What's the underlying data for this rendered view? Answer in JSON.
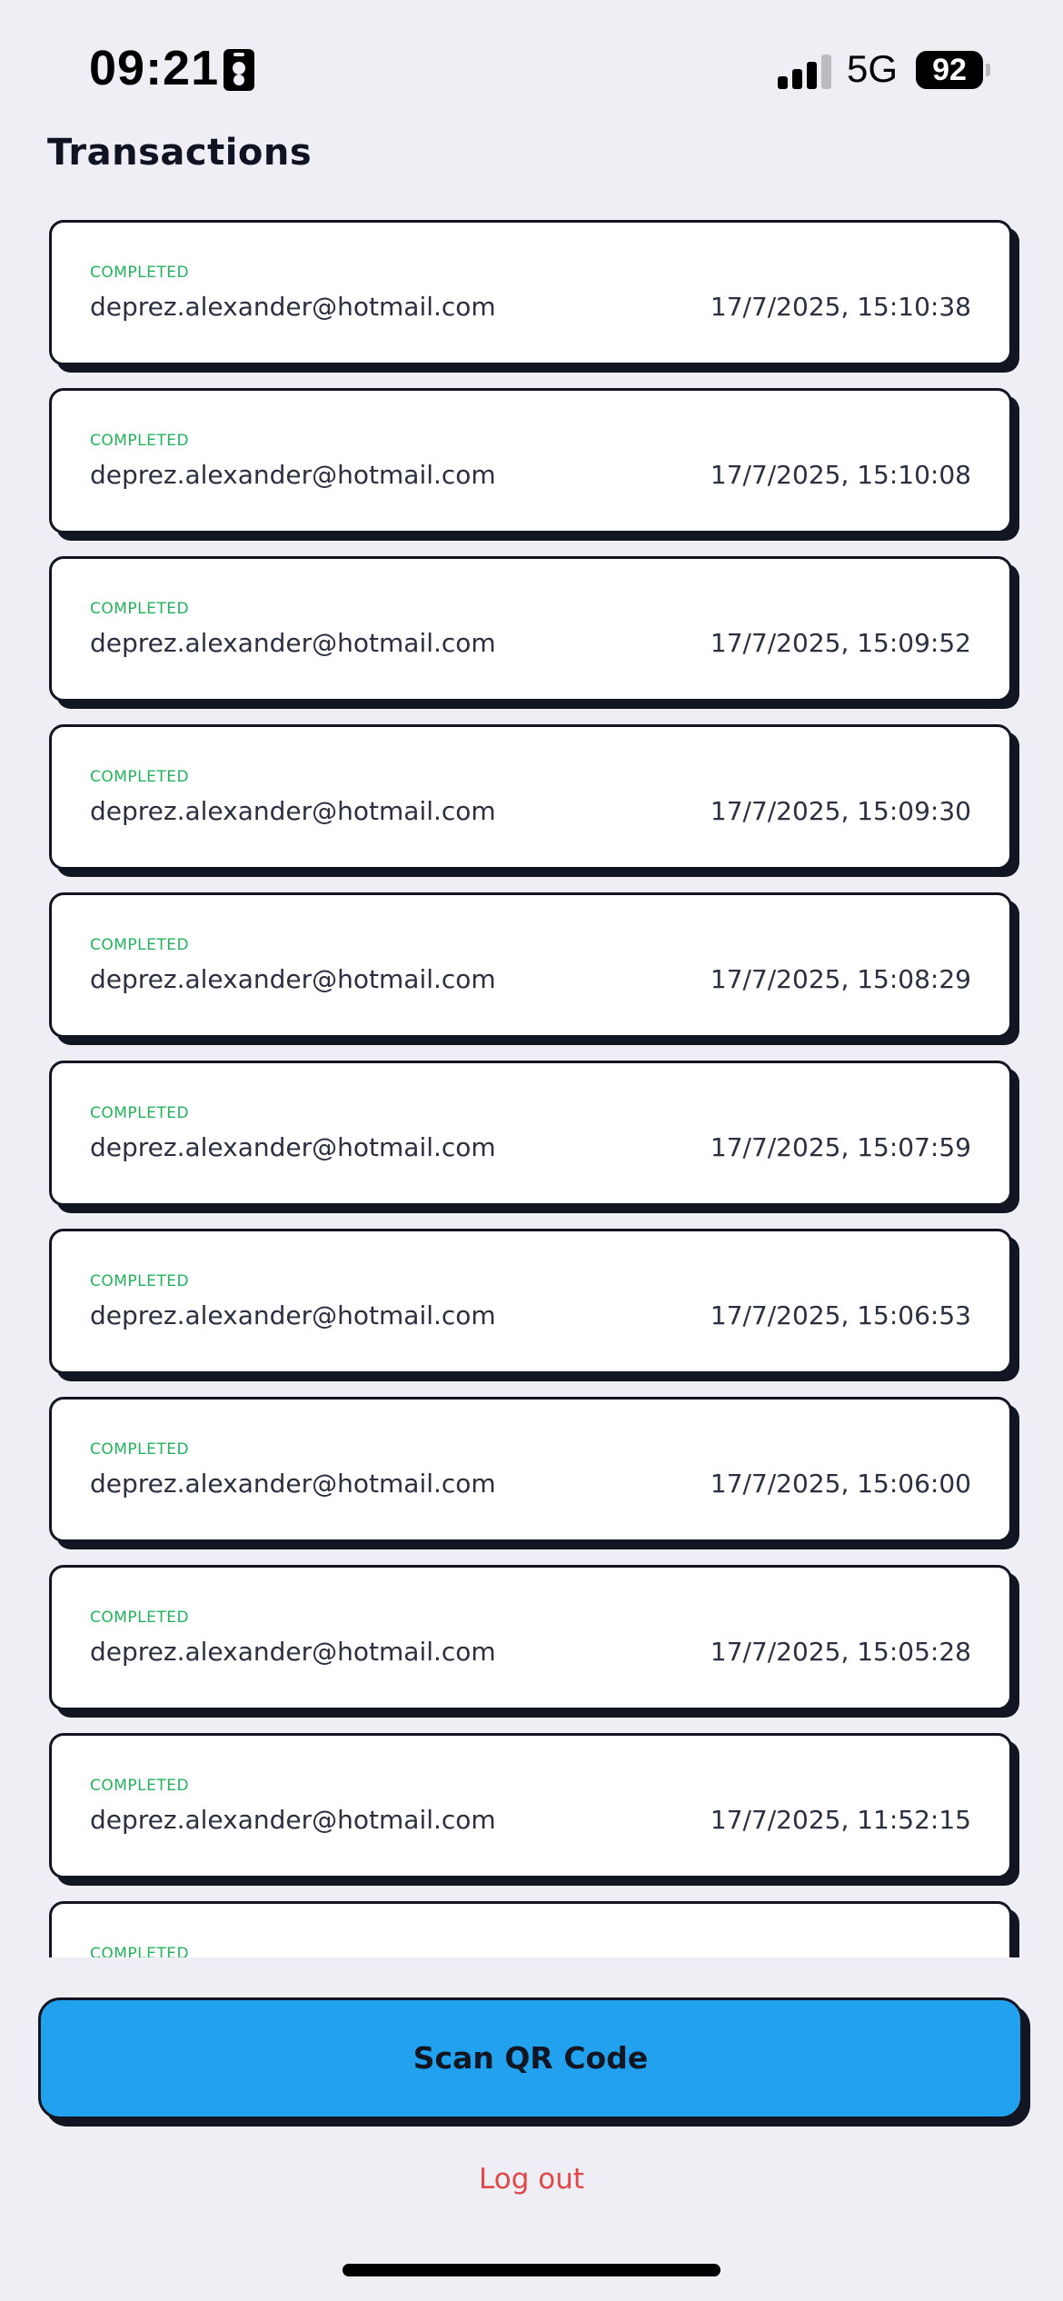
{
  "status_bar": {
    "time": "09:21",
    "network": "5G",
    "battery": "92"
  },
  "header": {
    "title": "Transactions"
  },
  "transactions": [
    {
      "status": "COMPLETED",
      "email": "deprez.alexander@hotmail.com",
      "date": "17/7/2025, 15:10:38"
    },
    {
      "status": "COMPLETED",
      "email": "deprez.alexander@hotmail.com",
      "date": "17/7/2025, 15:10:08"
    },
    {
      "status": "COMPLETED",
      "email": "deprez.alexander@hotmail.com",
      "date": "17/7/2025, 15:09:52"
    },
    {
      "status": "COMPLETED",
      "email": "deprez.alexander@hotmail.com",
      "date": "17/7/2025, 15:09:30"
    },
    {
      "status": "COMPLETED",
      "email": "deprez.alexander@hotmail.com",
      "date": "17/7/2025, 15:08:29"
    },
    {
      "status": "COMPLETED",
      "email": "deprez.alexander@hotmail.com",
      "date": "17/7/2025, 15:07:59"
    },
    {
      "status": "COMPLETED",
      "email": "deprez.alexander@hotmail.com",
      "date": "17/7/2025, 15:06:53"
    },
    {
      "status": "COMPLETED",
      "email": "deprez.alexander@hotmail.com",
      "date": "17/7/2025, 15:06:00"
    },
    {
      "status": "COMPLETED",
      "email": "deprez.alexander@hotmail.com",
      "date": "17/7/2025, 15:05:28"
    },
    {
      "status": "COMPLETED",
      "email": "deprez.alexander@hotmail.com",
      "date": "17/7/2025, 11:52:15"
    },
    {
      "status": "COMPLETED",
      "email": "",
      "date": ""
    }
  ],
  "actions": {
    "scan_label": "Scan QR Code",
    "logout_label": "Log out"
  },
  "colors": {
    "status_completed": "#22b45c",
    "scan_button": "#22a2ee",
    "logout": "#e04848",
    "background": "#efeef4"
  }
}
